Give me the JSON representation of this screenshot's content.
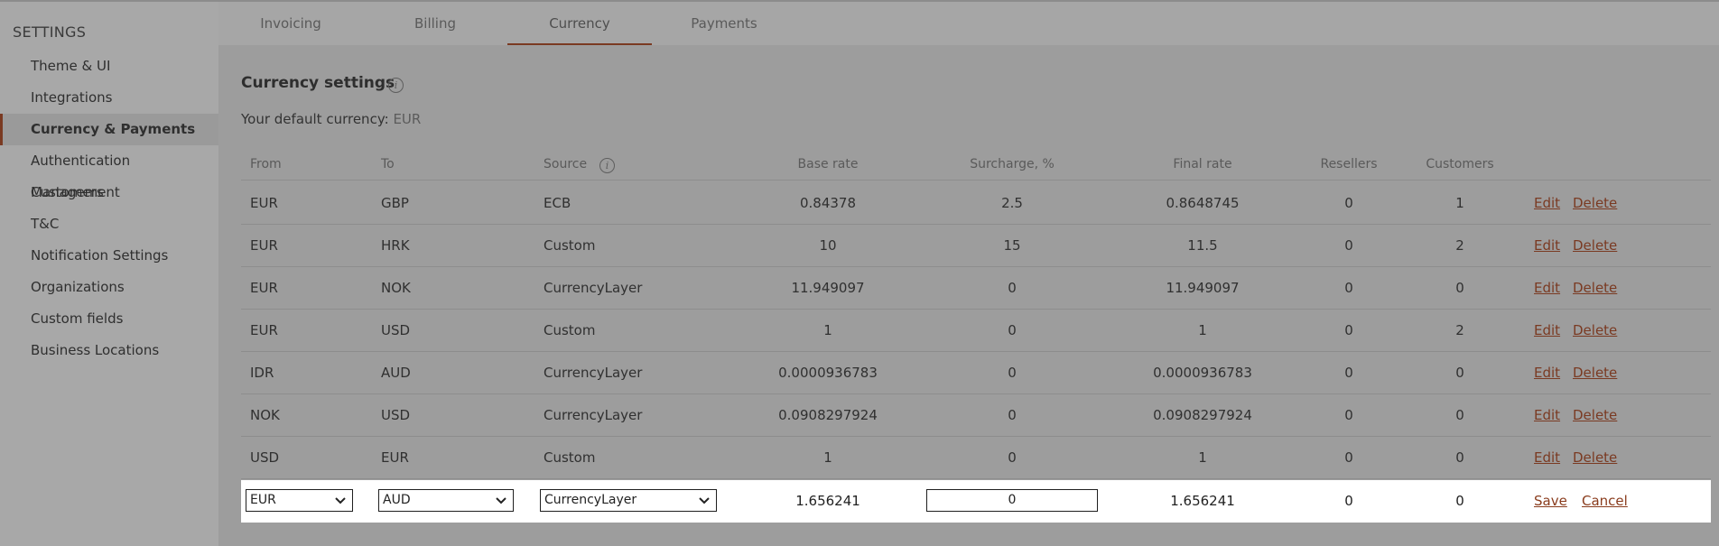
{
  "sidebar": {
    "title": "SETTINGS",
    "items": [
      {
        "label": "Theme & UI"
      },
      {
        "label": "Integrations"
      },
      {
        "label": "Currency & Payments",
        "active": true
      },
      {
        "label": "Authentication Management"
      },
      {
        "label": "Customers"
      },
      {
        "label": "T&C"
      },
      {
        "label": "Notification Settings"
      },
      {
        "label": "Organizations"
      },
      {
        "label": "Custom fields"
      },
      {
        "label": "Business Locations"
      }
    ]
  },
  "tabs": [
    {
      "label": "Invoicing"
    },
    {
      "label": "Billing"
    },
    {
      "label": "Currency",
      "active": true
    },
    {
      "label": "Payments"
    }
  ],
  "section": {
    "title": "Currency settings",
    "default_label": "Your default currency:",
    "default_value": "EUR"
  },
  "table": {
    "headers": {
      "from": "From",
      "to": "To",
      "source": "Source",
      "base_rate": "Base rate",
      "surcharge": "Surcharge, %",
      "final_rate": "Final rate",
      "resellers": "Resellers",
      "customers": "Customers"
    },
    "rows": [
      {
        "from": "EUR",
        "to": "GBP",
        "source": "ECB",
        "base_rate": "0.84378",
        "surcharge": "2.5",
        "final_rate": "0.8648745",
        "resellers": "0",
        "customers": "1",
        "edit": "Edit",
        "delete": "Delete"
      },
      {
        "from": "EUR",
        "to": "HRK",
        "source": "Custom",
        "base_rate": "10",
        "surcharge": "15",
        "final_rate": "11.5",
        "resellers": "0",
        "customers": "2",
        "edit": "Edit",
        "delete": "Delete"
      },
      {
        "from": "EUR",
        "to": "NOK",
        "source": "CurrencyLayer",
        "base_rate": "11.949097",
        "surcharge": "0",
        "final_rate": "11.949097",
        "resellers": "0",
        "customers": "0",
        "edit": "Edit",
        "delete": "Delete"
      },
      {
        "from": "EUR",
        "to": "USD",
        "source": "Custom",
        "base_rate": "1",
        "surcharge": "0",
        "final_rate": "1",
        "resellers": "0",
        "customers": "2",
        "edit": "Edit",
        "delete": "Delete"
      },
      {
        "from": "IDR",
        "to": "AUD",
        "source": "CurrencyLayer",
        "base_rate": "0.0000936783",
        "surcharge": "0",
        "final_rate": "0.0000936783",
        "resellers": "0",
        "customers": "0",
        "edit": "Edit",
        "delete": "Delete"
      },
      {
        "from": "NOK",
        "to": "USD",
        "source": "CurrencyLayer",
        "base_rate": "0.0908297924",
        "surcharge": "0",
        "final_rate": "0.0908297924",
        "resellers": "0",
        "customers": "0",
        "edit": "Edit",
        "delete": "Delete"
      },
      {
        "from": "USD",
        "to": "EUR",
        "source": "Custom",
        "base_rate": "1",
        "surcharge": "0",
        "final_rate": "1",
        "resellers": "0",
        "customers": "0",
        "edit": "Edit",
        "delete": "Delete"
      }
    ],
    "edit_row": {
      "from": "EUR",
      "to": "AUD",
      "source": "CurrencyLayer",
      "base_rate": "1.656241",
      "surcharge": "0",
      "final_rate": "1.656241",
      "resellers": "0",
      "customers": "0",
      "save": "Save",
      "cancel": "Cancel"
    }
  },
  "colors": {
    "accent": "#7a3a22",
    "overlay_background": "#9d9d9d",
    "edit_row_background": "#ffffff"
  },
  "icons": {
    "info": "info-circle-icon",
    "dropdown": "chevron-down-icon"
  }
}
